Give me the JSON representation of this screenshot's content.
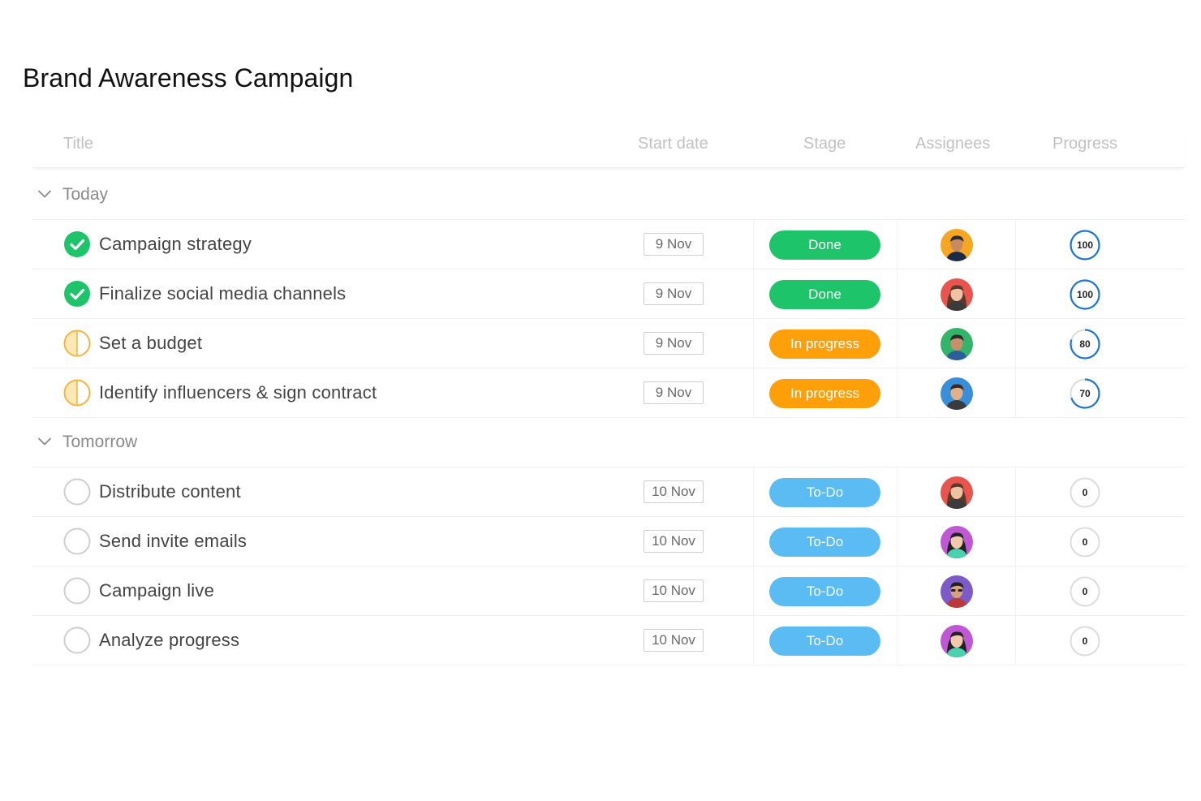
{
  "page": {
    "title": "Brand Awareness Campaign"
  },
  "columns": {
    "title": "Title",
    "start_date": "Start date",
    "stage": "Stage",
    "assignees": "Assignees",
    "progress": "Progress"
  },
  "colors": {
    "done": "#1ec46a",
    "in_progress": "#ff9f0a",
    "todo": "#5bbcf3",
    "ring_blue": "#1976d2",
    "ring_grey": "#dddddd",
    "half_orange": "#f7b437",
    "half_fill": "#fde8b6"
  },
  "groups": [
    {
      "label": "Today",
      "tasks": [
        {
          "title": "Campaign strategy",
          "status": "done",
          "date": "9 Nov",
          "stage": "Done",
          "stage_key": "done",
          "avatar": "avatar-orange-man",
          "progress": 100
        },
        {
          "title": "Finalize social media channels",
          "status": "done",
          "date": "9 Nov",
          "stage": "Done",
          "stage_key": "done",
          "avatar": "avatar-red-woman",
          "progress": 100
        },
        {
          "title": "Set a budget",
          "status": "in_progress",
          "date": "9 Nov",
          "stage": "In progress",
          "stage_key": "in_progress",
          "avatar": "avatar-green-man",
          "progress": 80
        },
        {
          "title": "Identify influencers & sign contract",
          "status": "in_progress",
          "date": "9 Nov",
          "stage": "In progress",
          "stage_key": "in_progress",
          "avatar": "avatar-blue-man",
          "progress": 70
        }
      ]
    },
    {
      "label": "Tomorrow",
      "tasks": [
        {
          "title": "Distribute content",
          "status": "todo",
          "date": "10 Nov",
          "stage": "To-Do",
          "stage_key": "todo",
          "avatar": "avatar-red-woman",
          "progress": 0
        },
        {
          "title": "Send invite emails",
          "status": "todo",
          "date": "10 Nov",
          "stage": "To-Do",
          "stage_key": "todo",
          "avatar": "avatar-pink-woman",
          "progress": 0
        },
        {
          "title": "Campaign live",
          "status": "todo",
          "date": "10 Nov",
          "stage": "To-Do",
          "stage_key": "todo",
          "avatar": "avatar-purple-man",
          "progress": 0
        },
        {
          "title": "Analyze progress",
          "status": "todo",
          "date": "10 Nov",
          "stage": "To-Do",
          "stage_key": "todo",
          "avatar": "avatar-pink-woman",
          "progress": 0
        }
      ]
    }
  ]
}
